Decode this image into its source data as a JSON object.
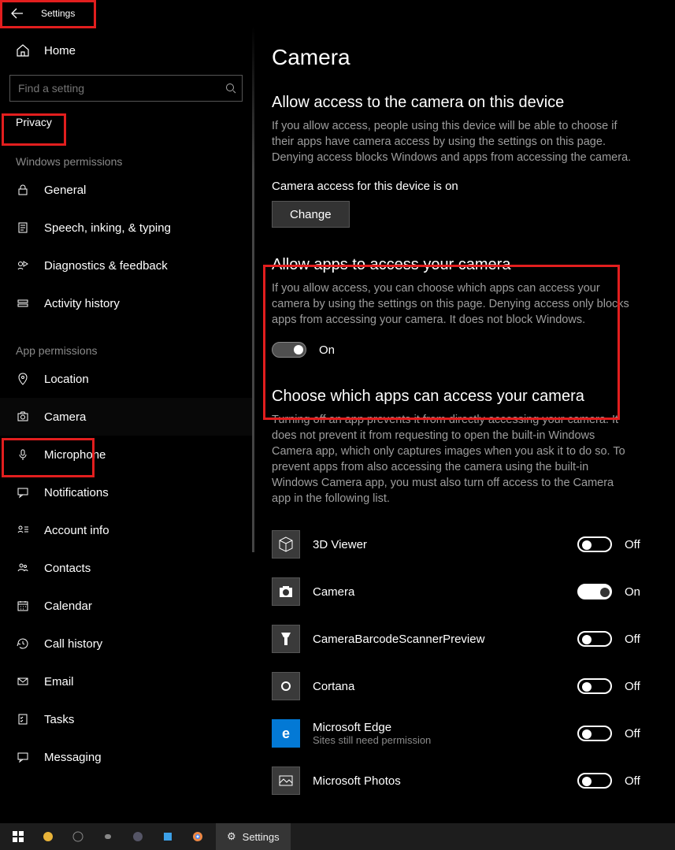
{
  "titlebar": {
    "app_name": "Settings"
  },
  "sidebar": {
    "home_label": "Home",
    "search_placeholder": "Find a setting",
    "category_label": "Privacy",
    "group1_title": "Windows permissions",
    "group1": [
      {
        "label": "General"
      },
      {
        "label": "Speech, inking, & typing"
      },
      {
        "label": "Diagnostics & feedback"
      },
      {
        "label": "Activity history"
      }
    ],
    "group2_title": "App permissions",
    "group2": [
      {
        "label": "Location"
      },
      {
        "label": "Camera"
      },
      {
        "label": "Microphone"
      },
      {
        "label": "Notifications"
      },
      {
        "label": "Account info"
      },
      {
        "label": "Contacts"
      },
      {
        "label": "Calendar"
      },
      {
        "label": "Call history"
      },
      {
        "label": "Email"
      },
      {
        "label": "Tasks"
      },
      {
        "label": "Messaging"
      }
    ]
  },
  "main": {
    "page_title": "Camera",
    "section1_title": "Allow access to the camera on this device",
    "section1_desc": "If you allow access, people using this device will be able to choose if their apps have camera access by using the settings on this page. Denying access blocks Windows and apps from accessing the camera.",
    "status_line": "Camera access for this device is on",
    "change_btn": "Change",
    "section2_title": "Allow apps to access your camera",
    "section2_desc": "If you allow access, you can choose which apps can access your camera by using the settings on this page. Denying access only blocks apps from accessing your camera. It does not block Windows.",
    "allow_apps_toggle_state": "On",
    "section3_title": "Choose which apps can access your camera",
    "section3_desc": "Turning off an app prevents it from directly accessing your camera. It does not prevent it from requesting to open the built-in Windows Camera app, which only captures images when you ask it to do so. To prevent apps from also accessing the camera using the built-in Windows Camera app, you must also turn off access to the Camera app in the following list.",
    "apps": [
      {
        "name": "3D Viewer",
        "sub": "",
        "state": "Off",
        "on": false,
        "icon": "cube"
      },
      {
        "name": "Camera",
        "sub": "",
        "state": "On",
        "on": true,
        "icon": "camera"
      },
      {
        "name": "CameraBarcodeScannerPreview",
        "sub": "",
        "state": "Off",
        "on": false,
        "icon": "scanner"
      },
      {
        "name": "Cortana",
        "sub": "",
        "state": "Off",
        "on": false,
        "icon": "circle"
      },
      {
        "name": "Microsoft Edge",
        "sub": "Sites still need permission",
        "state": "Off",
        "on": false,
        "icon": "edge"
      },
      {
        "name": "Microsoft Photos",
        "sub": "",
        "state": "Off",
        "on": false,
        "icon": "photos"
      }
    ]
  },
  "taskbar": {
    "active_app_label": "Settings"
  }
}
